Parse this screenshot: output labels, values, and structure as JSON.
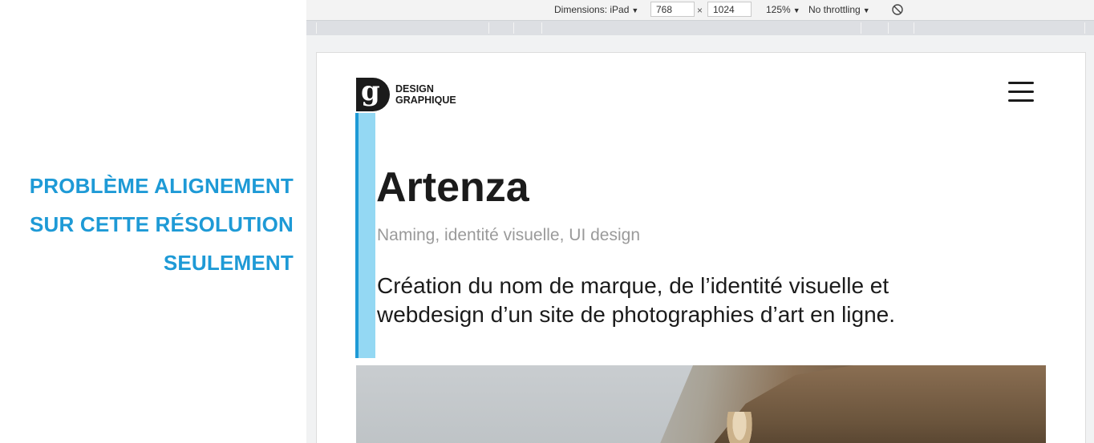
{
  "annotation": {
    "lines": [
      "PROBLÈME ALIGNEMENT",
      "SUR CETTE RÉSOLUTION",
      "SEULEMENT"
    ],
    "color": "#1e9ad6"
  },
  "devtools": {
    "dimensions_label": "Dimensions: iPad",
    "width": "768",
    "times": "×",
    "height": "1024",
    "zoom": "125%",
    "throttling": "No throttling",
    "rotate_icon": "rotate-icon"
  },
  "site": {
    "logo_letter": "g",
    "logo_line1": "DESIGN",
    "logo_line2": "GRAPHIQUE",
    "menu_icon": "hamburger-menu-icon",
    "title": "Artenza",
    "subtitle": "Naming, identité visuelle, UI design",
    "description": "Création du nom de marque, de l’identité visuelle et webdesign d’un site de photographies d’art en ligne.",
    "accent_color": "#1e9ad6",
    "accent_light_color": "#94d8f3"
  }
}
